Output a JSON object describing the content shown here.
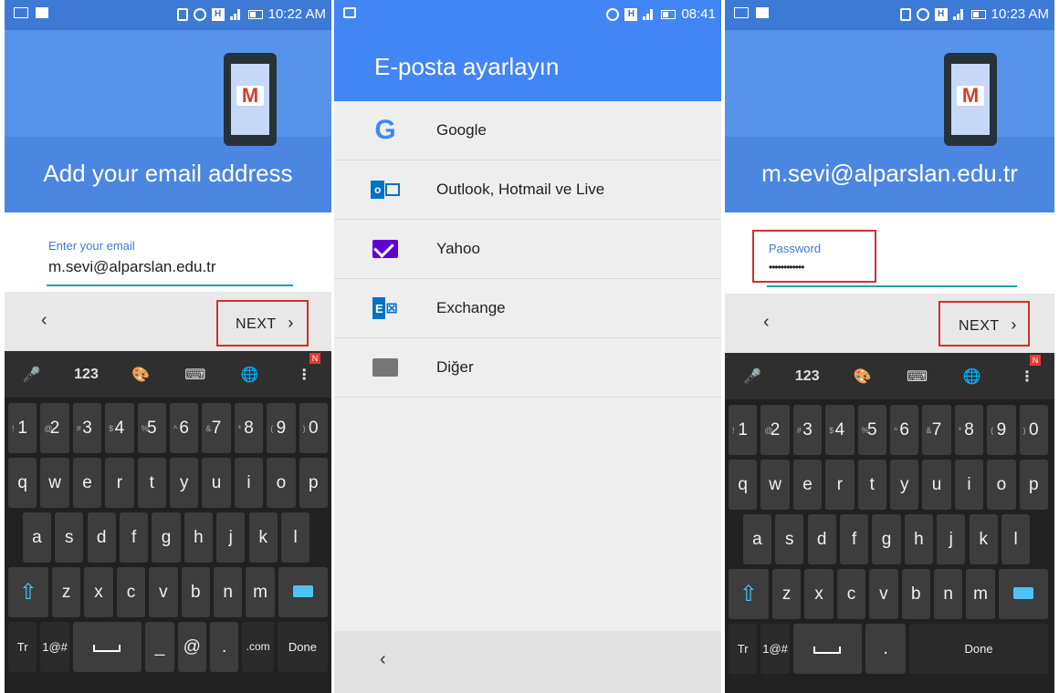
{
  "panel1": {
    "status": {
      "time": "10:22 AM"
    },
    "header_title": "Add your email address",
    "email_label": "Enter your email",
    "email_value": "m.sevi@alparslan.edu.tr",
    "back": "‹",
    "next": "NEXT",
    "next_arrow": "›"
  },
  "panel2": {
    "status": {
      "time": "08:41"
    },
    "title": "E-posta ayarlayın",
    "providers": [
      {
        "name": "Google",
        "icon": "google-icon"
      },
      {
        "name": "Outlook, Hotmail ve Live",
        "icon": "outlook-icon"
      },
      {
        "name": "Yahoo",
        "icon": "yahoo-mail-icon"
      },
      {
        "name": "Exchange",
        "icon": "exchange-icon"
      },
      {
        "name": "Diğer",
        "icon": "mail-icon"
      }
    ],
    "back": "‹"
  },
  "panel3": {
    "status": {
      "time": "10:23 AM"
    },
    "header_title": "m.sevi@alparslan.edu.tr",
    "password_label": "Password",
    "password_value": "••••••••••••",
    "back": "‹",
    "next": "NEXT",
    "next_arrow": "›"
  },
  "keyboard": {
    "toolbar": [
      "mic-icon",
      "123",
      "palette-icon",
      "keyboard-icon",
      "globe-icon",
      "more-icon"
    ],
    "toolbar_123": "123",
    "badge": "N",
    "row1": [
      "1",
      "2",
      "3",
      "4",
      "5",
      "6",
      "7",
      "8",
      "9",
      "0"
    ],
    "row1_sub": [
      "!",
      "@",
      "#",
      "$",
      "%",
      "^",
      "&",
      "*",
      "(",
      ")"
    ],
    "row2": [
      "q",
      "w",
      "e",
      "r",
      "t",
      "y",
      "u",
      "i",
      "o",
      "p"
    ],
    "row3": [
      "a",
      "s",
      "d",
      "f",
      "g",
      "h",
      "j",
      "k",
      "l"
    ],
    "row4": [
      "z",
      "x",
      "c",
      "v",
      "b",
      "n",
      "m"
    ],
    "tr": "Tr",
    "sym": "1@#",
    "at": "@",
    "dotcom": ".com",
    "done": "Done",
    "comma": ",",
    "dot": "."
  },
  "colors": {
    "header_blue": "#4b86e0",
    "accent_teal": "#1fa3a3",
    "highlight_red": "#d32f2f",
    "material_blue": "#4285f4"
  }
}
